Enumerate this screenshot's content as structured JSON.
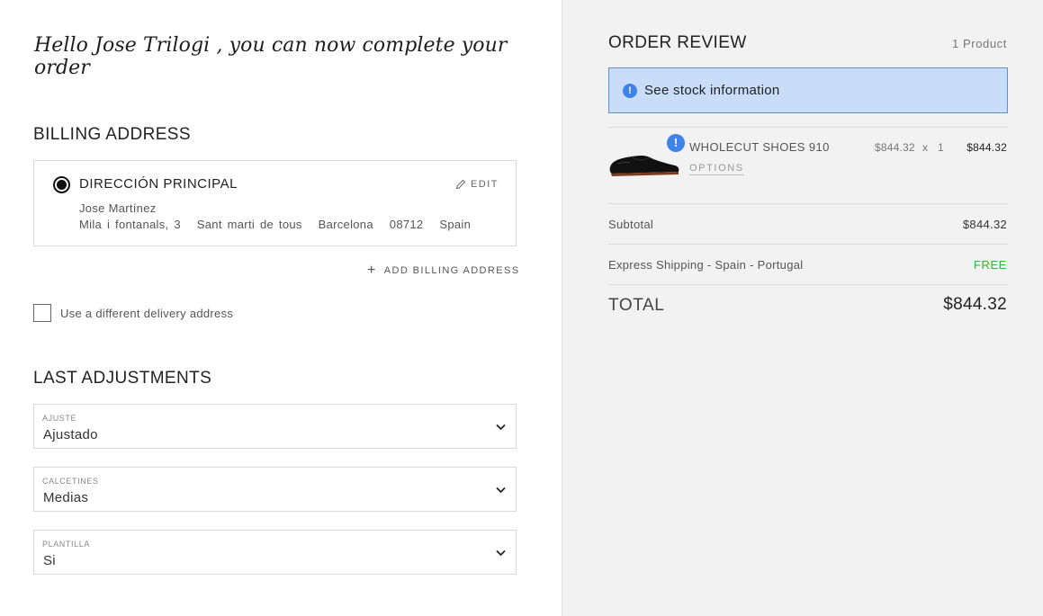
{
  "greeting": "Hello Jose Trilogi , you can now complete your order",
  "billing": {
    "title": "BILLING ADDRESS",
    "address": {
      "name": "DIRECCIÓN PRINCIPAL",
      "edit_label": "EDIT",
      "person": "Jose Martínez",
      "street": "Mila i fontanals, 3",
      "town": "Sant marti de tous",
      "city": "Barcelona",
      "zip": "08712",
      "country": "Spain"
    },
    "add_label": "ADD BILLING ADDRESS",
    "different_delivery_label": "Use a different delivery address"
  },
  "adjustments": {
    "title": "LAST ADJUSTMENTS",
    "selects": [
      {
        "label": "AJUSTE",
        "value": "Ajustado"
      },
      {
        "label": "CALCETINES",
        "value": "Medias"
      },
      {
        "label": "PLANTILLA",
        "value": "Si"
      }
    ]
  },
  "order": {
    "title": "ORDER REVIEW",
    "count": "1 Product",
    "stock_banner": "See stock information",
    "product": {
      "name": "WHOLECUT SHOES 910",
      "options_label": "OPTIONS",
      "unit_price": "$844.32",
      "times": "x",
      "qty": "1",
      "line_total": "$844.32"
    },
    "subtotal_label": "Subtotal",
    "subtotal_value": "$844.32",
    "shipping_label": "Express Shipping - Spain - Portugal",
    "shipping_value": "FREE",
    "total_label": "TOTAL",
    "total_value": "$844.32"
  },
  "colors": {
    "accent_blue": "#3f82e8",
    "banner_bg": "#c9dcf8",
    "free_green": "#31b23b",
    "panel_bg": "#f2f2f2"
  },
  "icons": {
    "edit": "pencil-icon",
    "add": "plus-icon",
    "info": "info-icon",
    "warning": "exclamation-icon",
    "select": "chevron-down-icon"
  }
}
